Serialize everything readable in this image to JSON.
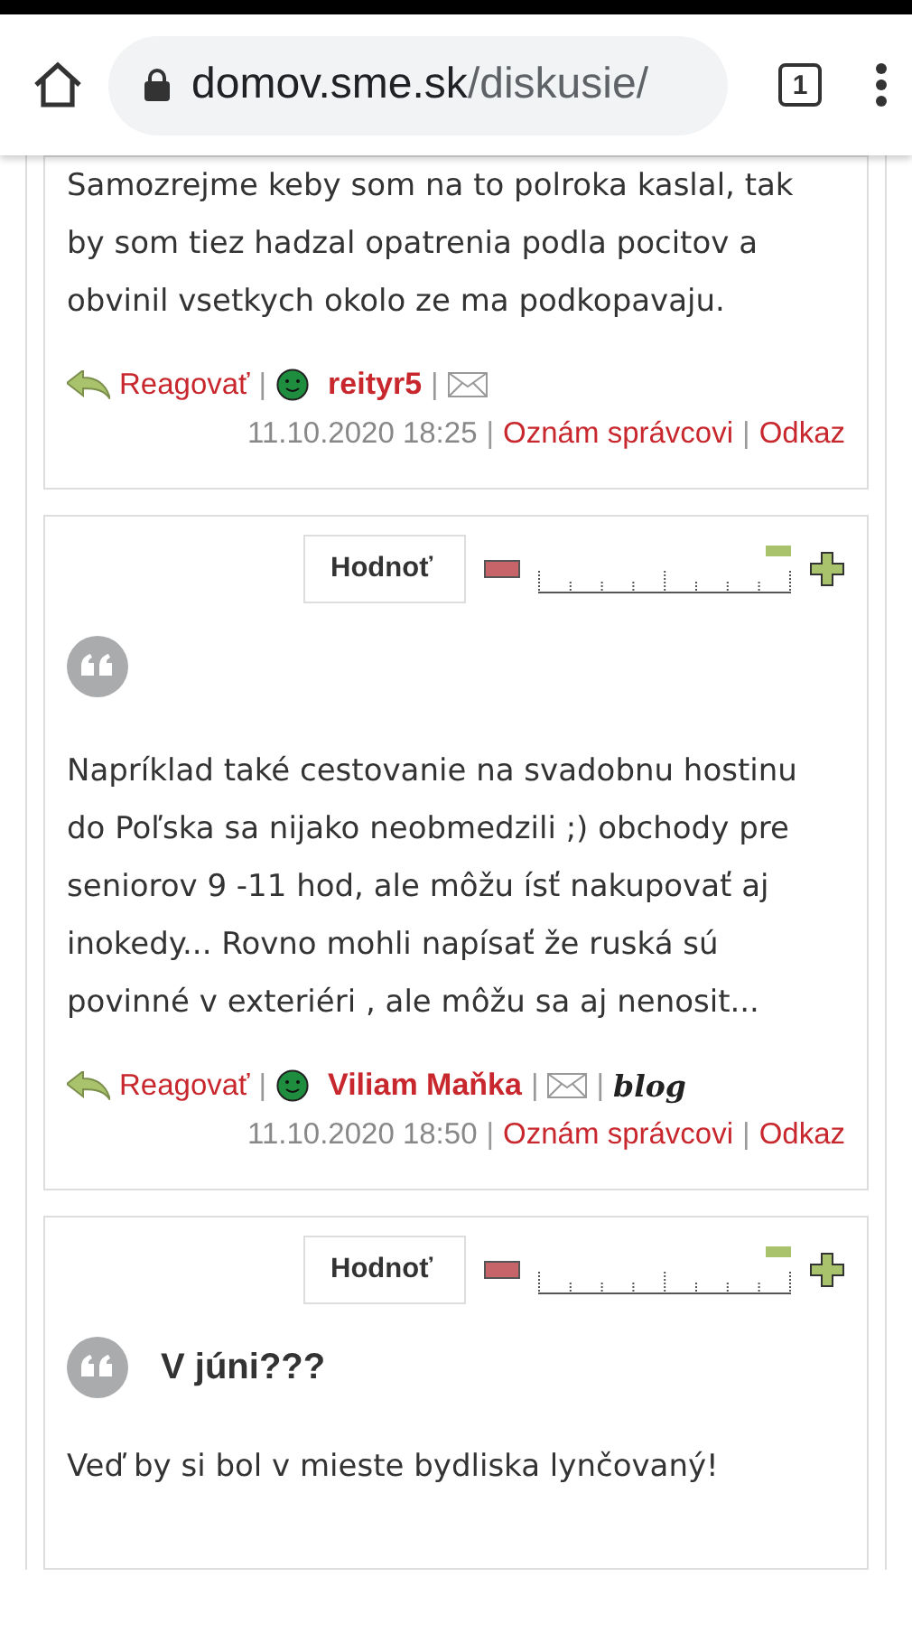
{
  "browser": {
    "url_host": "domov.sme.sk",
    "url_path": "/diskusie/",
    "tab_count": "1"
  },
  "comments": [
    {
      "text": "Samozrejme keby som na to polroka kaslal, tak by som tiez hadzal opatrenia podla pocitov a obvinil vsetkych okolo ze ma podkopavaju.",
      "reply": "Reagovať",
      "separator": "|",
      "author": "reityr5",
      "date": "11.10.2020 18:25",
      "report": "Oznám správcovi",
      "link": "Odkaz"
    },
    {
      "rating": {
        "label": "Hodnoť"
      },
      "text": "Napríklad také cestovanie na svadobnu hostinu do Poľska sa nijako neobmedzili ;) obchody pre seniorov 9 -11 hod, ale môžu ísť nakupovať aj inokedy... Rovno mohli napísať že ruská sú povinné v exteriéri , ale môžu sa aj nenosit...",
      "reply": "Reagovať",
      "separator": "|",
      "author": "Viliam Maňka",
      "blog": "blog",
      "date": "11.10.2020 18:50",
      "report": "Oznám správcovi",
      "link": "Odkaz"
    },
    {
      "rating": {
        "label": "Hodnoť"
      },
      "title": "V júni???",
      "text": "Veď by si bol v mieste bydliska lynčovaný!"
    }
  ]
}
